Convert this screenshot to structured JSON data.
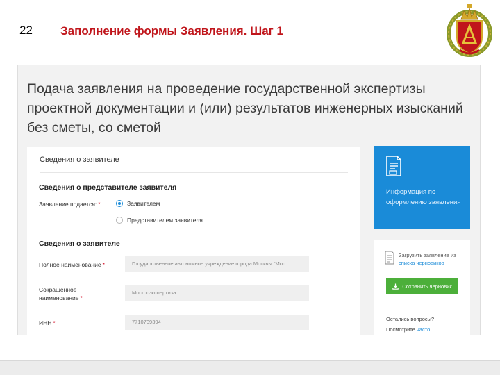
{
  "slide": {
    "number": "22",
    "title": "Заполнение формы Заявления. Шаг 1",
    "emblem_icon": "coat-of-arms-emblem"
  },
  "page": {
    "heading": "Подача заявления на проведение государственной экспертизы проектной документации и (или) результатов инженерных изысканий без сметы, со сметой"
  },
  "form": {
    "section_title": "Сведения о заявителе",
    "representative_title": "Сведения о представителе заявителя",
    "submitted_by_label": "Заявление подается:",
    "required_mark": "*",
    "radio_options": [
      {
        "label": "Заявителем",
        "checked": true
      },
      {
        "label": "Представителем заявителя",
        "checked": false
      }
    ],
    "applicant_title": "Сведения о заявителе",
    "full_name_label": "Полное наименование",
    "full_name_value": "Государственное автономное учреждение города Москвы \"Мос",
    "short_name_label_1": "Сокращенное",
    "short_name_label_2": "наименование",
    "short_name_value": "Мосгосэкспертиза",
    "inn_label": "ИНН",
    "inn_value": "7710709394"
  },
  "sidebar": {
    "info_label": "Информация по оформлению заявления",
    "upload_text": "Загрузить заявление из",
    "upload_link": "списка черновиков",
    "save_draft_label": "Сохранить черновик",
    "questions_label": "Остались вопросы?",
    "see_label": "Посмотрите",
    "often_link": "часто"
  },
  "colors": {
    "title_red": "#c0151b",
    "accent_blue": "#1a8bd8",
    "save_green": "#4caf3a",
    "required_red": "#d0021b"
  }
}
